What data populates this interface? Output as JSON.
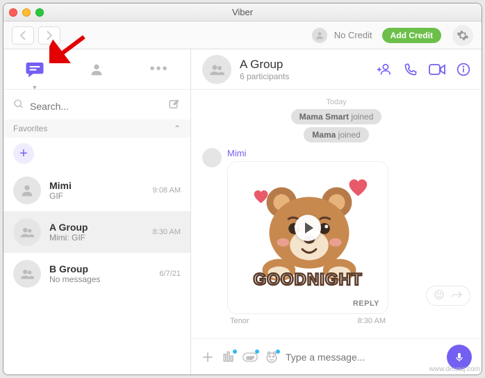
{
  "window": {
    "title": "Viber"
  },
  "toolbar": {
    "credit_label": "No Credit",
    "add_credit_label": "Add Credit"
  },
  "sidebar": {
    "search_placeholder": "Search...",
    "favorites_label": "Favorites",
    "chats": [
      {
        "name": "Mimi",
        "preview": "GIF",
        "time": "9:08 AM",
        "type": "person"
      },
      {
        "name": "A Group",
        "preview": "Mimi: GIF",
        "time": "8:30 AM",
        "type": "group"
      },
      {
        "name": "B Group",
        "preview": "No messages",
        "time": "6/7/21",
        "type": "group"
      }
    ]
  },
  "chat": {
    "name": "A Group",
    "participants": "6 participants",
    "day": "Today",
    "system": [
      {
        "who": "Mama Smart",
        "action": "joined"
      },
      {
        "who": "Mama",
        "action": "joined"
      }
    ],
    "message": {
      "sender": "Mimi",
      "gif_text": "GOODNIGHT",
      "reply_label": "REPLY",
      "source": "Tenor",
      "time": "8:30 AM"
    }
  },
  "composer": {
    "placeholder": "Type a message..."
  },
  "watermark": "www.deuaq.com"
}
